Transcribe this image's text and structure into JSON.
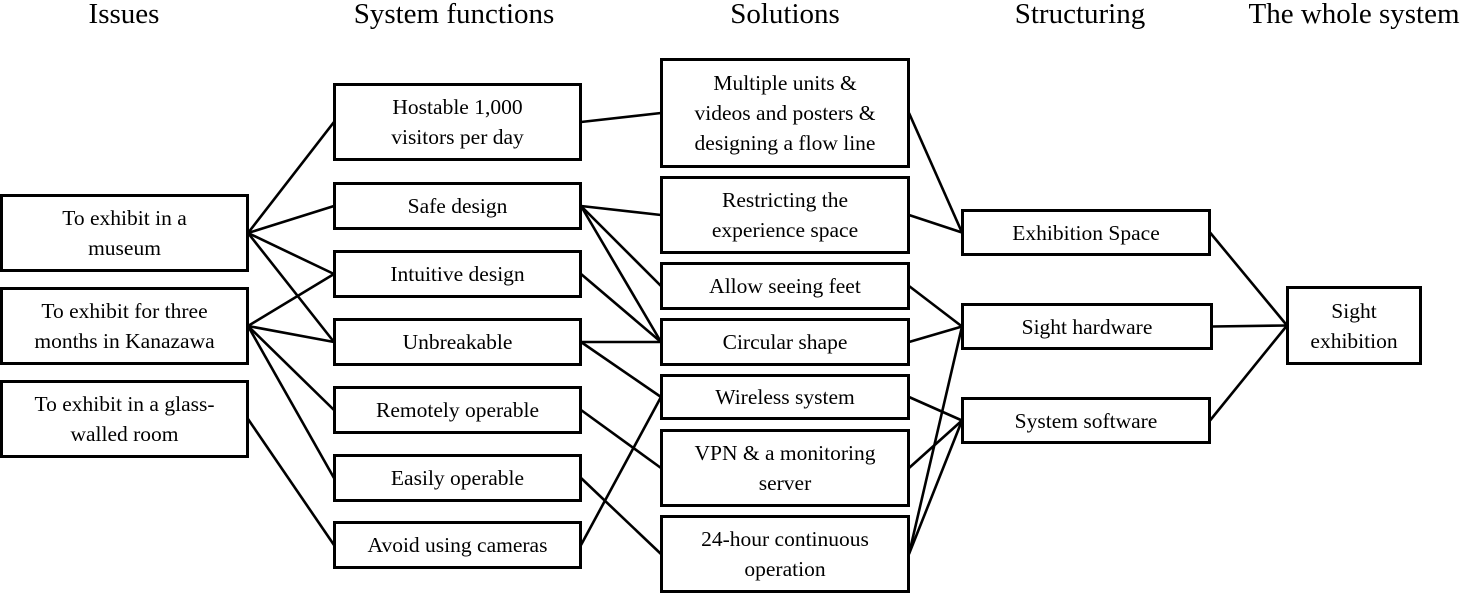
{
  "columns": [
    {
      "id": "issues",
      "header": "Issues"
    },
    {
      "id": "functions",
      "header": "System functions"
    },
    {
      "id": "solutions",
      "header": "Solutions"
    },
    {
      "id": "structuring",
      "header": "Structuring"
    },
    {
      "id": "whole",
      "header": "The whole system"
    }
  ],
  "nodes": {
    "issues": [
      {
        "id": "i1",
        "label": "To exhibit in a\nmuseum"
      },
      {
        "id": "i2",
        "label": "To exhibit for three\nmonths in Kanazawa"
      },
      {
        "id": "i3",
        "label": "To exhibit in a glass-\nwalled room"
      }
    ],
    "functions": [
      {
        "id": "f1",
        "label": "Hostable 1,000\nvisitors per day"
      },
      {
        "id": "f2",
        "label": "Safe design"
      },
      {
        "id": "f3",
        "label": "Intuitive design"
      },
      {
        "id": "f4",
        "label": "Unbreakable"
      },
      {
        "id": "f5",
        "label": "Remotely operable"
      },
      {
        "id": "f6",
        "label": "Easily operable"
      },
      {
        "id": "f7",
        "label": "Avoid using cameras"
      }
    ],
    "solutions": [
      {
        "id": "s1",
        "label": "Multiple units &\nvideos and posters &\ndesigning a flow line"
      },
      {
        "id": "s2",
        "label": "Restricting the\nexperience space"
      },
      {
        "id": "s3",
        "label": "Allow seeing feet"
      },
      {
        "id": "s4",
        "label": "Circular shape"
      },
      {
        "id": "s5",
        "label": "Wireless  system"
      },
      {
        "id": "s6",
        "label": "VPN & a monitoring\nserver"
      },
      {
        "id": "s7",
        "label": "24-hour continuous\noperation"
      }
    ],
    "structuring": [
      {
        "id": "t1",
        "label": "Exhibition Space"
      },
      {
        "id": "t2",
        "label": "Sight hardware"
      },
      {
        "id": "t3",
        "label": "System software"
      }
    ],
    "whole": [
      {
        "id": "w1",
        "label": "Sight\nexhibition"
      }
    ]
  },
  "edges": [
    [
      "i1",
      "f1"
    ],
    [
      "i1",
      "f2"
    ],
    [
      "i1",
      "f3"
    ],
    [
      "i1",
      "f4"
    ],
    [
      "i2",
      "f3"
    ],
    [
      "i2",
      "f4"
    ],
    [
      "i2",
      "f5"
    ],
    [
      "i2",
      "f6"
    ],
    [
      "i3",
      "f7"
    ],
    [
      "f1",
      "s1"
    ],
    [
      "f2",
      "s2"
    ],
    [
      "f2",
      "s3"
    ],
    [
      "f2",
      "s4"
    ],
    [
      "f3",
      "s4"
    ],
    [
      "f4",
      "s4"
    ],
    [
      "f4",
      "s5"
    ],
    [
      "f5",
      "s6"
    ],
    [
      "f6",
      "s7"
    ],
    [
      "f7",
      "s5"
    ],
    [
      "s1",
      "t1"
    ],
    [
      "s2",
      "t1"
    ],
    [
      "s3",
      "t2"
    ],
    [
      "s4",
      "t2"
    ],
    [
      "s7",
      "t2"
    ],
    [
      "s5",
      "t3"
    ],
    [
      "s6",
      "t3"
    ],
    [
      "s7",
      "t3"
    ],
    [
      "t1",
      "w1"
    ],
    [
      "t2",
      "w1"
    ],
    [
      "t3",
      "w1"
    ]
  ]
}
